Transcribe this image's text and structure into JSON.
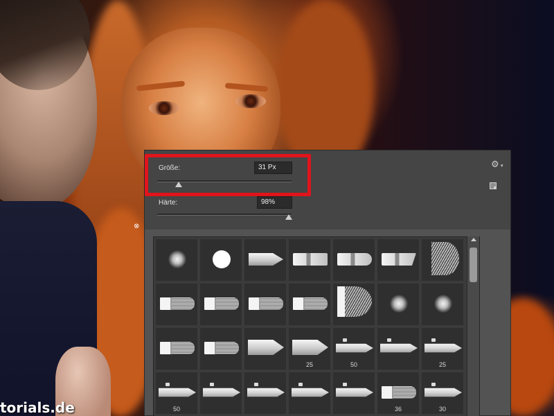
{
  "panel": {
    "size_label": "Größe:",
    "size_value": "31 Px",
    "size_slider_fraction": 0.16,
    "hardness_label": "Härte:",
    "hardness_value": "98%",
    "hardness_slider_fraction": 0.98,
    "highlight_color": "#e0141b",
    "icons": {
      "settings": "gear-icon",
      "new_preset": "new-preset-icon"
    }
  },
  "brushes": [
    {
      "tip": "soft-round",
      "size": ""
    },
    {
      "tip": "hard-round",
      "size": ""
    },
    {
      "tip": "round-point-stiff",
      "size": ""
    },
    {
      "tip": "flat-blunt",
      "size": ""
    },
    {
      "tip": "round-blunt",
      "size": ""
    },
    {
      "tip": "flat-angle",
      "size": ""
    },
    {
      "tip": "flat-fan",
      "size": ""
    },
    {
      "tip": "bristle-flat",
      "size": ""
    },
    {
      "tip": "bristle-flat",
      "size": ""
    },
    {
      "tip": "bristle-flat",
      "size": ""
    },
    {
      "tip": "bristle-flat",
      "size": ""
    },
    {
      "tip": "bristle-fan",
      "size": ""
    },
    {
      "tip": "soft-round",
      "size": ""
    },
    {
      "tip": "soft-round",
      "size": ""
    },
    {
      "tip": "bristle-flat",
      "size": ""
    },
    {
      "tip": "bristle-flat",
      "size": ""
    },
    {
      "tip": "pencil",
      "size": ""
    },
    {
      "tip": "pencil",
      "size": "25"
    },
    {
      "tip": "airbrush",
      "size": "50"
    },
    {
      "tip": "airbrush",
      "size": ""
    },
    {
      "tip": "airbrush",
      "size": "25"
    },
    {
      "tip": "airbrush",
      "size": "50"
    },
    {
      "tip": "airbrush",
      "size": ""
    },
    {
      "tip": "airbrush",
      "size": ""
    },
    {
      "tip": "airbrush",
      "size": ""
    },
    {
      "tip": "airbrush",
      "size": ""
    },
    {
      "tip": "bristle-flat",
      "size": "36"
    },
    {
      "tip": "airbrush",
      "size": "30"
    }
  ],
  "watermark": "torials.de",
  "cursor_glyph": "⊗"
}
